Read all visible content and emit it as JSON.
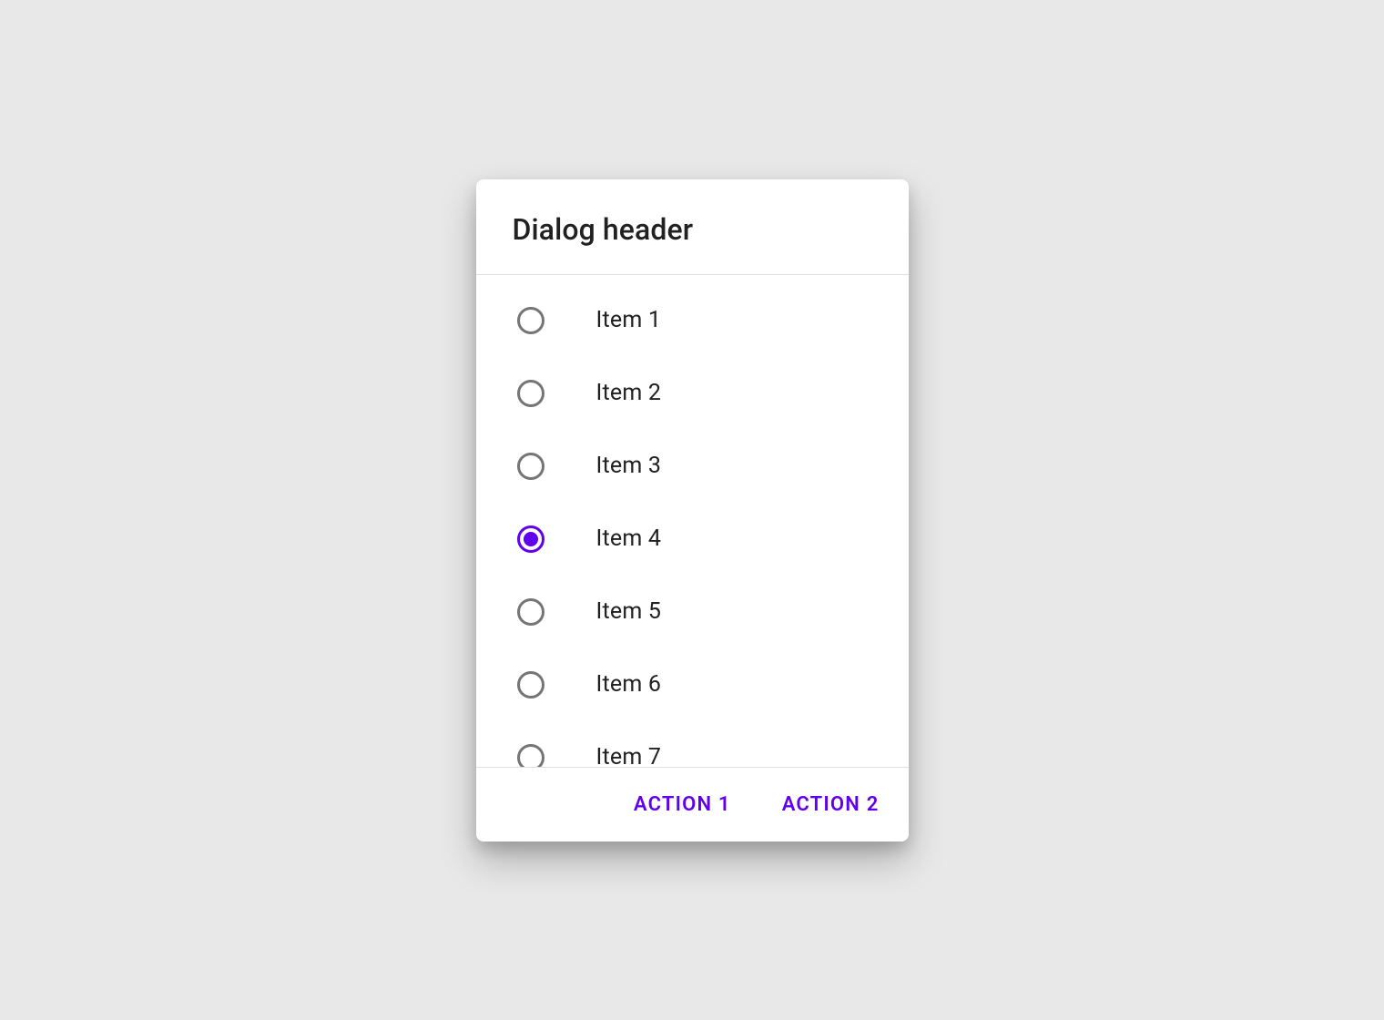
{
  "dialog": {
    "title": "Dialog header",
    "items": [
      {
        "label": "Item 1",
        "selected": false
      },
      {
        "label": "Item 2",
        "selected": false
      },
      {
        "label": "Item 3",
        "selected": false
      },
      {
        "label": "Item 4",
        "selected": true
      },
      {
        "label": "Item 5",
        "selected": false
      },
      {
        "label": "Item 6",
        "selected": false
      },
      {
        "label": "Item 7",
        "selected": false
      }
    ],
    "actions": {
      "primary": "ACTION 1",
      "secondary": "ACTION 2"
    }
  },
  "colors": {
    "accent": "#6200ee"
  }
}
